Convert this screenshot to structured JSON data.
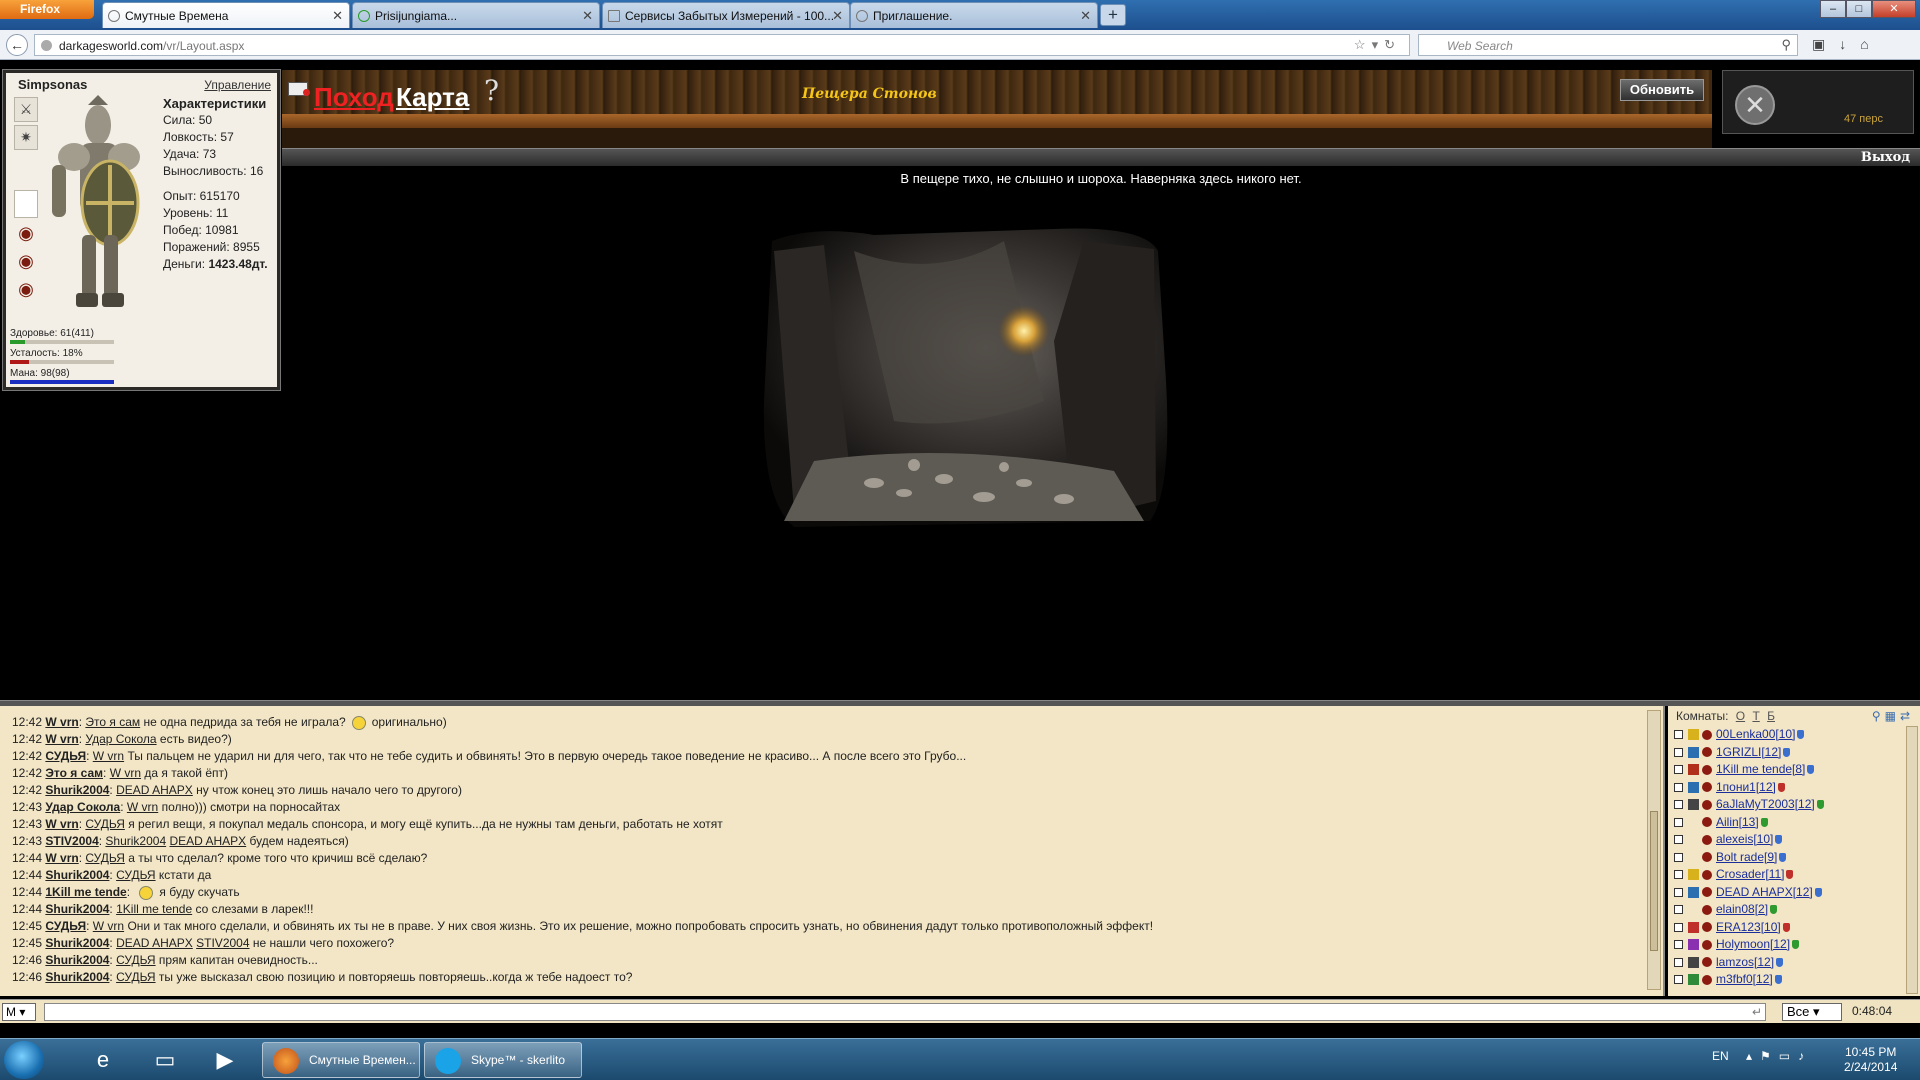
{
  "browser": {
    "app_menu": "Firefox",
    "tabs": [
      {
        "title": "Смутные Времена"
      },
      {
        "title": "Prisijungiama..."
      },
      {
        "title": "Сервисы Забытых Измерений - 100..."
      },
      {
        "title": "Приглашение."
      }
    ],
    "url_host": "darkagesworld.com",
    "url_path": "/vr/Layout.aspx",
    "search_placeholder": "Web Search"
  },
  "character": {
    "name": "Simpsonas",
    "manage_link": "Управление",
    "stats_title": "Характеристики",
    "strength": "Сила: 50",
    "agility": "Ловкость: 57",
    "luck": "Удача: 73",
    "endurance": "Выносливость: 16",
    "experience": "Опыт: 615170",
    "level": "Уровень: 11",
    "wins": "Побед: 10981",
    "losses": "Поражений: 8955",
    "money_label": "Деньги:",
    "money_value": "1423.48дт.",
    "health_label": "Здоровье: 61(411)",
    "fatigue_label": "Усталость: 18%",
    "mana_label": "Мана: 98(98)",
    "health_fraction": 0.148,
    "fatigue_fraction": 0.18,
    "mana_fraction": 1.0,
    "health_color": "#2a9a2a",
    "fatigue_color": "#b01818",
    "mana_color": "#1a2fbf"
  },
  "game": {
    "pohod_link": "Поход",
    "karta_link": "Карта",
    "help": "?",
    "location_title": "Пещера Стонов",
    "refresh_button": "Обновить",
    "online_count": "47 перс",
    "exit_link": "Выход",
    "location_message": "В пещере тихо, не слышно и шороха. Наверняка здесь никого нет."
  },
  "chat": {
    "messages": [
      {
        "time": "12:42",
        "nick": "W vrn",
        "to": "Это я сам",
        "text": " не одна педрида за тебя не играла?",
        "smile": true,
        "after": "оригинально)"
      },
      {
        "time": "12:42",
        "nick": "W vrn",
        "to": "Удар Сокола",
        "text": " есть видео?)"
      },
      {
        "time": "12:42",
        "nick": "СУДЬЯ",
        "to": "W vrn",
        "text": " Ты пальцем не ударил ни для чего, так что не тебе судить и обвинять! Это в первую очередь такое поведение не красиво... А после всего это Грубо..."
      },
      {
        "time": "12:42",
        "nick": "Это я сам",
        "to": "W vrn",
        "text": " да я такой ёпт)"
      },
      {
        "time": "12:42",
        "nick": "Shurik2004",
        "to": "DEAD AHAPX",
        "text": " ну чтож конец это лишь начало чего то другого)"
      },
      {
        "time": "12:43",
        "nick": "Удар Сокола",
        "to": "W vrn",
        "text": " полно))) смотри на порносайтах"
      },
      {
        "time": "12:43",
        "nick": "W vrn",
        "to": "СУДЬЯ",
        "text": " я регил вещи, я покупал медаль спонсора, и могу ещё купить...да не нужны там деньги, работать не хотят"
      },
      {
        "time": "12:43",
        "nick": "STIV2004",
        "to": "Shurik2004",
        "to2": "DEAD AHAPX",
        "text": " будем надеяться)"
      },
      {
        "time": "12:44",
        "nick": "W vrn",
        "to": "СУДЬЯ",
        "text": " а ты что сделал? кроме того что кричиш всё сделаю?"
      },
      {
        "time": "12:44",
        "nick": "Shurik2004",
        "to": "СУДЬЯ",
        "text": " кстати да"
      },
      {
        "time": "12:44",
        "nick": "1Kill me tende",
        "to": "",
        "text": "",
        "smile": true,
        "after": "я буду скучать"
      },
      {
        "time": "12:44",
        "nick": "Shurik2004",
        "to": "1Kill me tende",
        "text": " со слезами в ларек!!!"
      },
      {
        "time": "12:45",
        "nick": "СУДЬЯ",
        "to": "W vrn",
        "text": " Они и так много сделали, и обвинять их ты не в праве. У них своя жизнь. Это их решение, можно попробовать спросить узнать, но обвинения дадут только противоположный эффект!"
      },
      {
        "time": "12:45",
        "nick": "Shurik2004",
        "to": "DEAD AHAPX",
        "to2": "STIV2004",
        "text": " не нашли чего похожего?"
      },
      {
        "time": "12:46",
        "nick": "Shurik2004",
        "to": "СУДЬЯ",
        "text": " прям капитан очевидность..."
      },
      {
        "time": "12:46",
        "nick": "Shurik2004",
        "to": "СУДЬЯ",
        "text": " ты уже высказал свою позицию и повторяешь повторяешь..когда ж тебе надоест то?"
      }
    ]
  },
  "rooms": {
    "label": "Комнаты:",
    "filters": [
      "О",
      "Т",
      "Б"
    ],
    "users": [
      {
        "name": "00Lenka00[10]",
        "clan": "#d8b21c",
        "shield": "#3a6fd0"
      },
      {
        "name": "1GRIZLI[12]",
        "clan": "#2b6fb0",
        "shield": "#3a6fd0"
      },
      {
        "name": "1Kill me tende[8]",
        "clan": "#b0301c",
        "shield": "#3a6fd0"
      },
      {
        "name": "1пони1[12]",
        "clan": "#2b6fb0",
        "shield": "#c0302a"
      },
      {
        "name": "6aJlaMyT2003[12]",
        "clan": "#444444",
        "shield": "#2f9a2f"
      },
      {
        "name": "Ailin[13]",
        "clan": "",
        "shield": "#2f9a2f"
      },
      {
        "name": "alexeis[10]",
        "clan": "",
        "shield": "#3a6fd0"
      },
      {
        "name": "Bolt rade[9]",
        "clan": "",
        "shield": "#3a6fd0"
      },
      {
        "name": "Crosader[11]",
        "clan": "#d8b21c",
        "shield": "#c0302a"
      },
      {
        "name": "DEAD AHAPX[12]",
        "clan": "#2b6fb0",
        "shield": "#3a6fd0"
      },
      {
        "name": "elain08[2]",
        "clan": "",
        "shield": "#2f9a2f"
      },
      {
        "name": "ERA123[10]",
        "clan": "#c0302a",
        "shield": "#c0302a"
      },
      {
        "name": "Holymoon[12]",
        "clan": "#8a2fb0",
        "shield": "#2f9a2f"
      },
      {
        "name": "lamzos[12]",
        "clan": "#444444",
        "shield": "#3a6fd0"
      },
      {
        "name": "m3fbf0[12]",
        "clan": "#2f8a3a",
        "shield": "#3a6fd0"
      }
    ]
  },
  "input": {
    "mode": "M",
    "filter": "Все",
    "timer": "0:48:04"
  },
  "taskbar": {
    "firefox_task": "Смутные Времен...",
    "skype_task": "Skype™ - skerlito",
    "lang": "EN",
    "time": "10:45 PM",
    "date": "2/24/2014"
  }
}
